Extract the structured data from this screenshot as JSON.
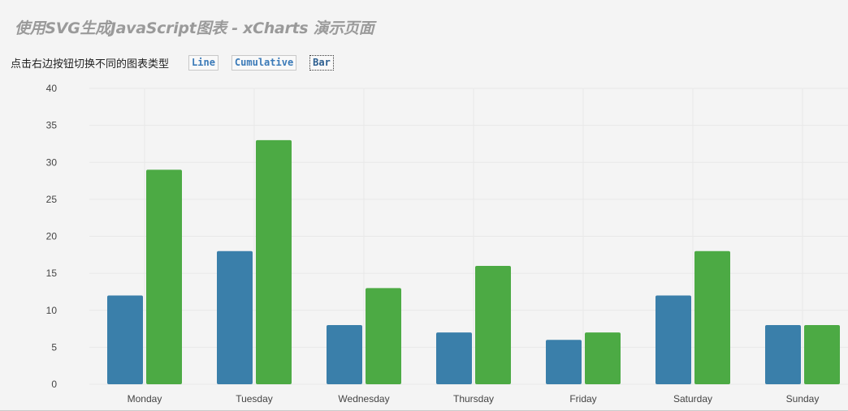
{
  "title": "使用SVG生成JavaScript图表 - xCharts 演示页面",
  "instruction": "点击右边按钮切换不同的图表类型",
  "buttons": [
    {
      "label": "Line",
      "active": false
    },
    {
      "label": "Cumulative",
      "active": false
    },
    {
      "label": "Bar",
      "active": true
    }
  ],
  "chart_data": {
    "type": "bar",
    "categories": [
      "Monday",
      "Tuesday",
      "Wednesday",
      "Thursday",
      "Friday",
      "Saturday",
      "Sunday"
    ],
    "series": [
      {
        "values": [
          12,
          18,
          8,
          7,
          6,
          12,
          8
        ],
        "color": "#3a7faa"
      },
      {
        "values": [
          29,
          33,
          13,
          16,
          7,
          18,
          8
        ],
        "color": "#4caa44"
      }
    ],
    "ylim": [
      0,
      40
    ],
    "yticks": [
      0,
      5,
      10,
      15,
      20,
      25,
      30,
      35,
      40
    ],
    "grid": true
  }
}
